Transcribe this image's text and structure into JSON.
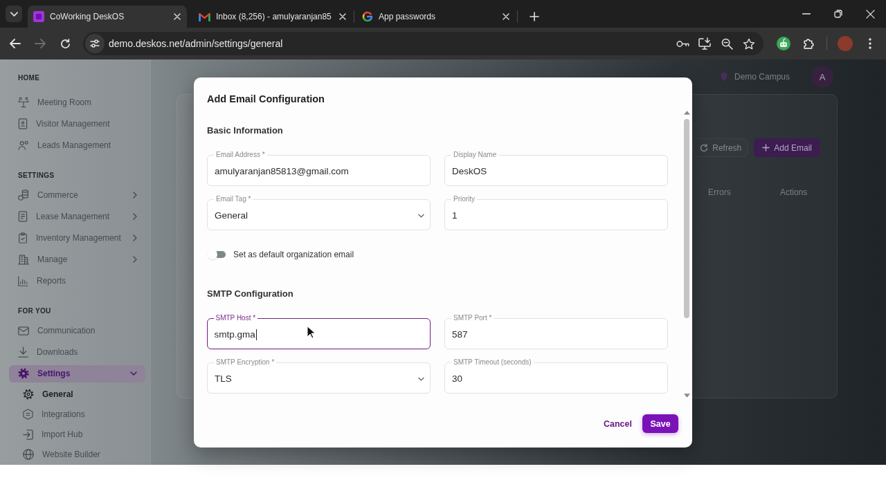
{
  "browser": {
    "tabs": [
      {
        "title": "CoWorking DeskOS",
        "selected": true
      },
      {
        "title": "Inbox (8,256) - amulyaranjan85",
        "selected": false
      },
      {
        "title": "App passwords",
        "selected": false
      }
    ],
    "navigation": [
      {
        "kind": "back",
        "disabled": false
      },
      {
        "kind": "forward",
        "disabled": true
      },
      {
        "kind": "reload",
        "disabled": false
      }
    ],
    "address": "demo.deskos.net/admin/settings/general"
  },
  "sidebar": {
    "sections": [
      {
        "title": "HOME",
        "items": [
          {
            "label": "Meeting Room",
            "kind": "link",
            "selected": false
          },
          {
            "label": "Visitor Management",
            "kind": "link",
            "selected": false
          },
          {
            "label": "Leads Management",
            "kind": "link",
            "selected": false
          }
        ]
      },
      {
        "title": "SETTINGS",
        "items": [
          {
            "label": "Commerce",
            "kind": "group",
            "expanded": false,
            "selected": false
          },
          {
            "label": "Lease Management",
            "kind": "group",
            "expanded": false,
            "selected": false
          },
          {
            "label": "Inventory Management",
            "kind": "group",
            "expanded": false,
            "selected": false
          },
          {
            "label": "Manage",
            "kind": "group",
            "expanded": false,
            "selected": false
          },
          {
            "label": "Reports",
            "kind": "link",
            "selected": false
          }
        ]
      },
      {
        "title": "FOR YOU",
        "items": [
          {
            "label": "Communication",
            "kind": "link",
            "selected": false
          },
          {
            "label": "Downloads",
            "kind": "link",
            "selected": false
          },
          {
            "label": "Settings",
            "kind": "group",
            "expanded": true,
            "selected": true,
            "children": [
              {
                "label": "General",
                "selected": true
              },
              {
                "label": "Integrations",
                "selected": false
              },
              {
                "label": "Import Hub",
                "selected": false
              },
              {
                "label": "Website Builder",
                "selected": false
              }
            ]
          }
        ]
      }
    ]
  },
  "header": {
    "location": "Demo Campus",
    "avatar": "A"
  },
  "email_settings": {
    "buttons": [
      {
        "label": "Refresh",
        "kind": "secondary"
      },
      {
        "label": "Add Email",
        "kind": "primary"
      }
    ],
    "table": {
      "columns": [
        "Errors",
        "Actions"
      ]
    }
  },
  "dialog": {
    "title": "Add Email Configuration",
    "sections": [
      {
        "title": "Basic Information",
        "fields": [
          {
            "label": "Email Address *",
            "value": "amulyaranjan85813@gmail.com",
            "kind": "text",
            "focused": false
          },
          {
            "label": "Display Name",
            "value": "DeskOS",
            "kind": "text",
            "focused": false
          },
          {
            "label": "Email Tag *",
            "value": "General",
            "kind": "select",
            "focused": false
          },
          {
            "label": "Priority",
            "value": "1",
            "kind": "text",
            "focused": false
          }
        ],
        "toggle": {
          "label": "Set as default organization email",
          "on": false
        }
      },
      {
        "title": "SMTP Configuration",
        "fields": [
          {
            "label": "SMTP Host *",
            "value": "smtp.gma",
            "kind": "text",
            "focused": true
          },
          {
            "label": "SMTP Port *",
            "value": "587",
            "kind": "text",
            "focused": false
          },
          {
            "label": "SMTP Encryption *",
            "value": "TLS",
            "kind": "select",
            "focused": false
          },
          {
            "label": "SMTP Timeout (seconds)",
            "value": "30",
            "kind": "text",
            "focused": false
          }
        ]
      }
    ],
    "buttons": [
      {
        "label": "Cancel",
        "kind": "text"
      },
      {
        "label": "Save",
        "kind": "primary"
      }
    ]
  }
}
